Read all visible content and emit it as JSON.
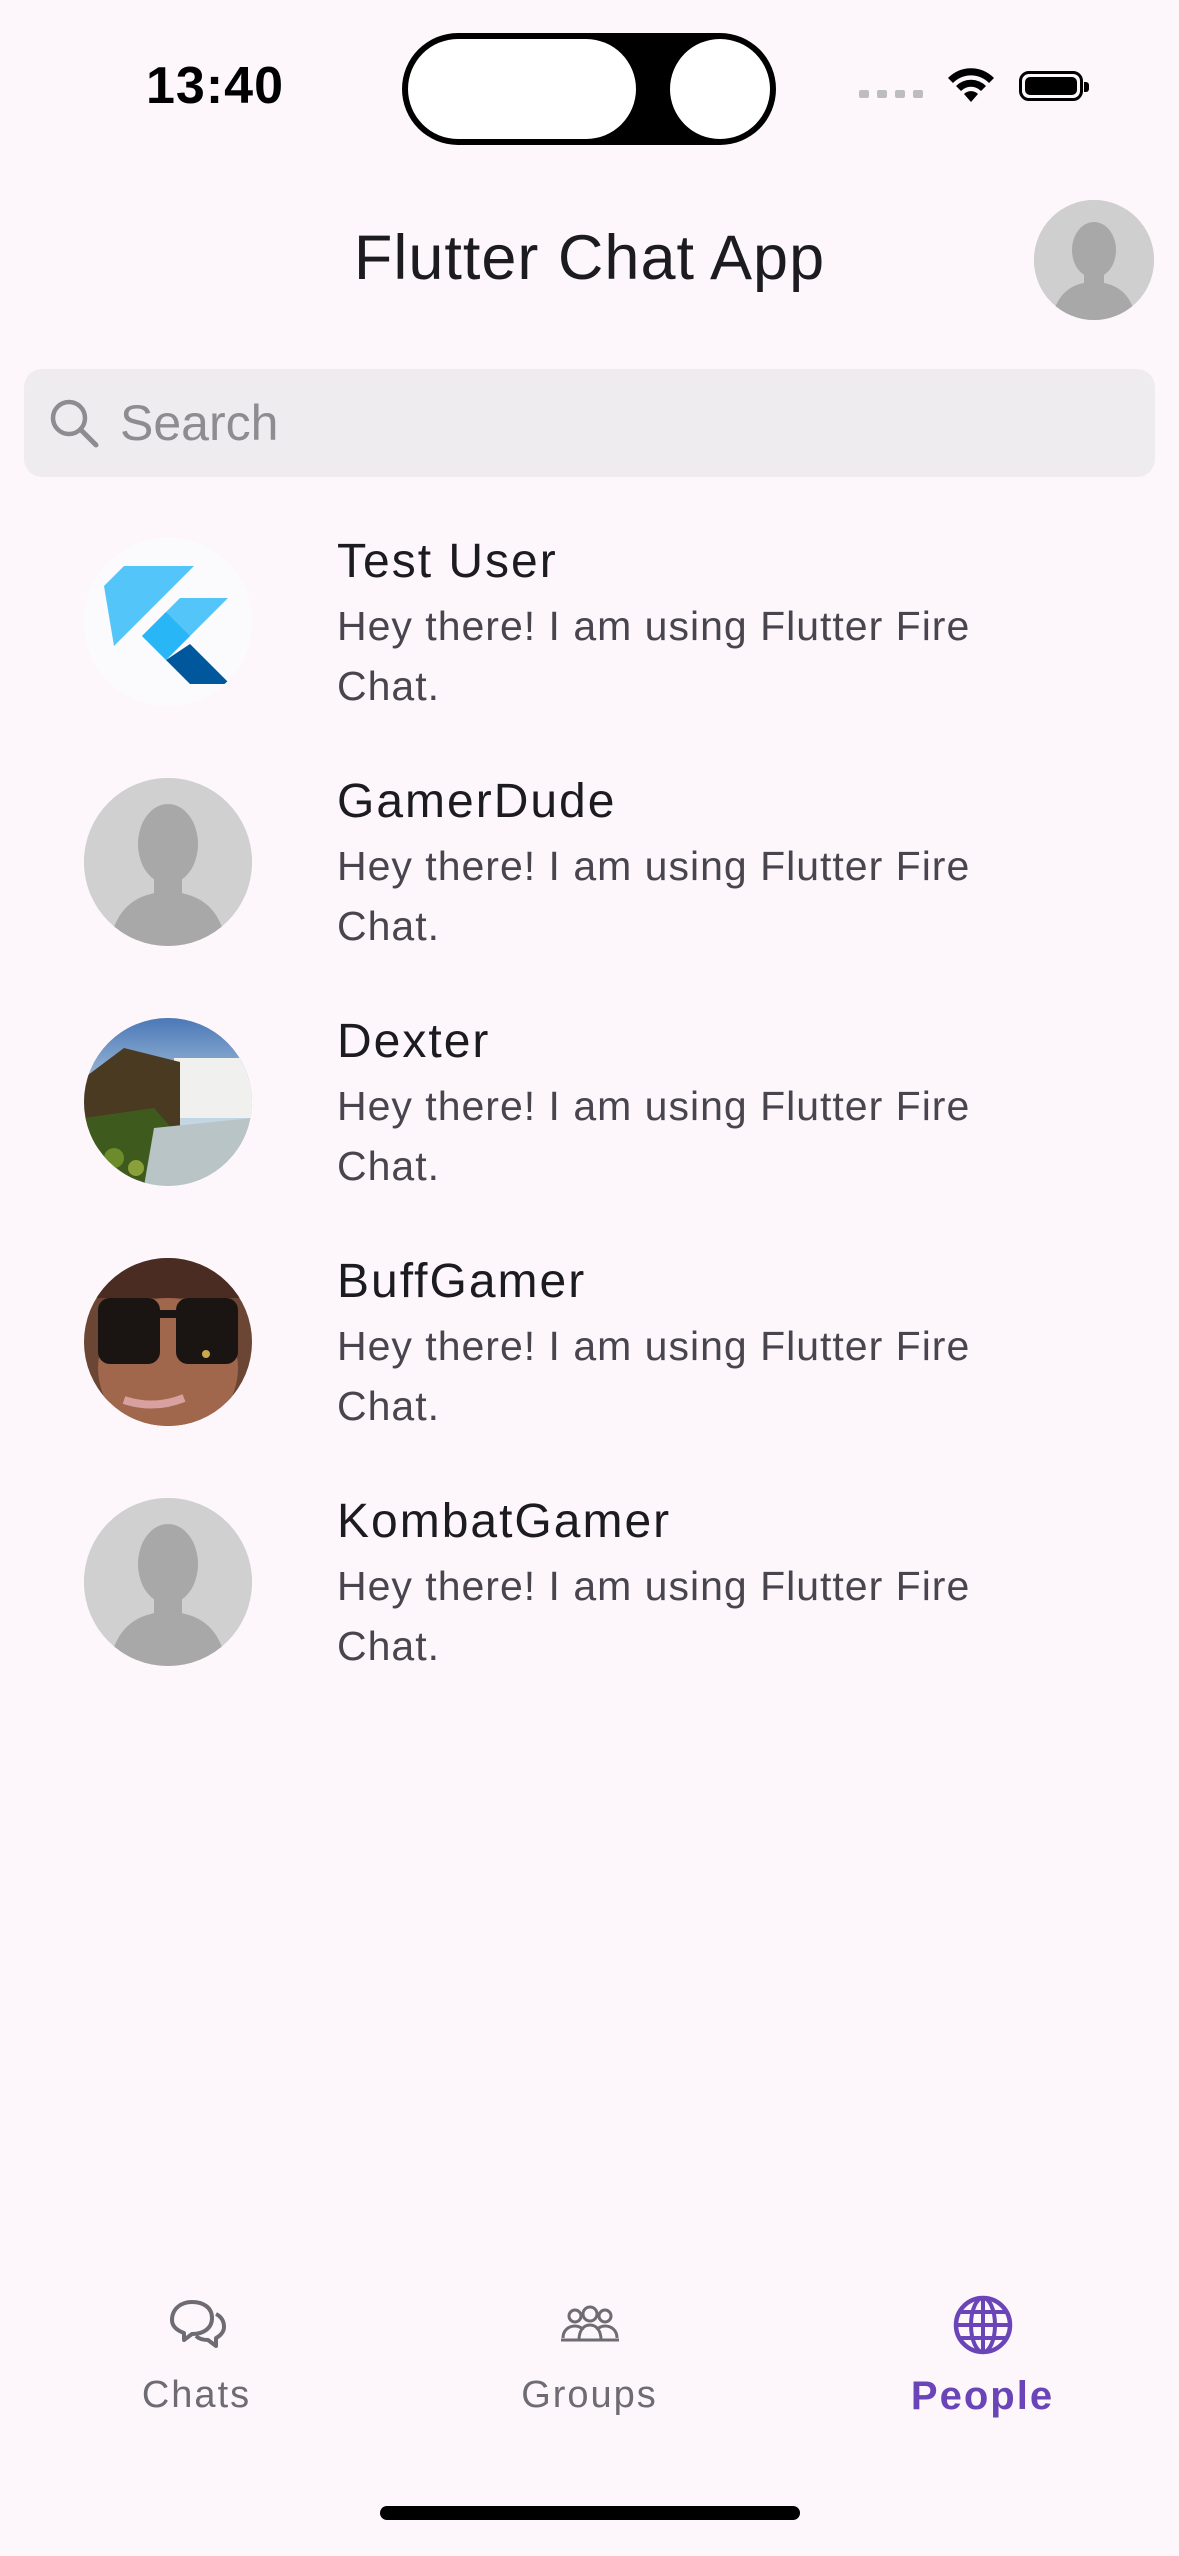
{
  "status_bar": {
    "time": "13:40"
  },
  "header": {
    "title": "Flutter Chat App"
  },
  "search": {
    "placeholder": "Search"
  },
  "people": [
    {
      "name": "Test User",
      "status": "Hey there! I am using Flutter Fire Chat.",
      "avatar": "flutter-logo"
    },
    {
      "name": "GamerDude",
      "status": "Hey there! I am using Flutter Fire Chat.",
      "avatar": "default-silhouette"
    },
    {
      "name": "Dexter",
      "status": "Hey there! I am using Flutter Fire Chat.",
      "avatar": "waterfall-photo"
    },
    {
      "name": "BuffGamer",
      "status": "Hey there! I am using Flutter Fire Chat.",
      "avatar": "sunglasses-photo"
    },
    {
      "name": "KombatGamer",
      "status": "Hey there! I am using Flutter Fire Chat.",
      "avatar": "default-silhouette"
    }
  ],
  "bottom_nav": {
    "items": [
      {
        "label": "Chats",
        "icon": "chat-bubbles-icon",
        "active": false
      },
      {
        "label": "Groups",
        "icon": "groups-icon",
        "active": false
      },
      {
        "label": "People",
        "icon": "globe-icon",
        "active": true
      }
    ]
  },
  "colors": {
    "accent": "#6a45b8",
    "background": "#fdf7fb",
    "search_bg": "#efecef"
  }
}
